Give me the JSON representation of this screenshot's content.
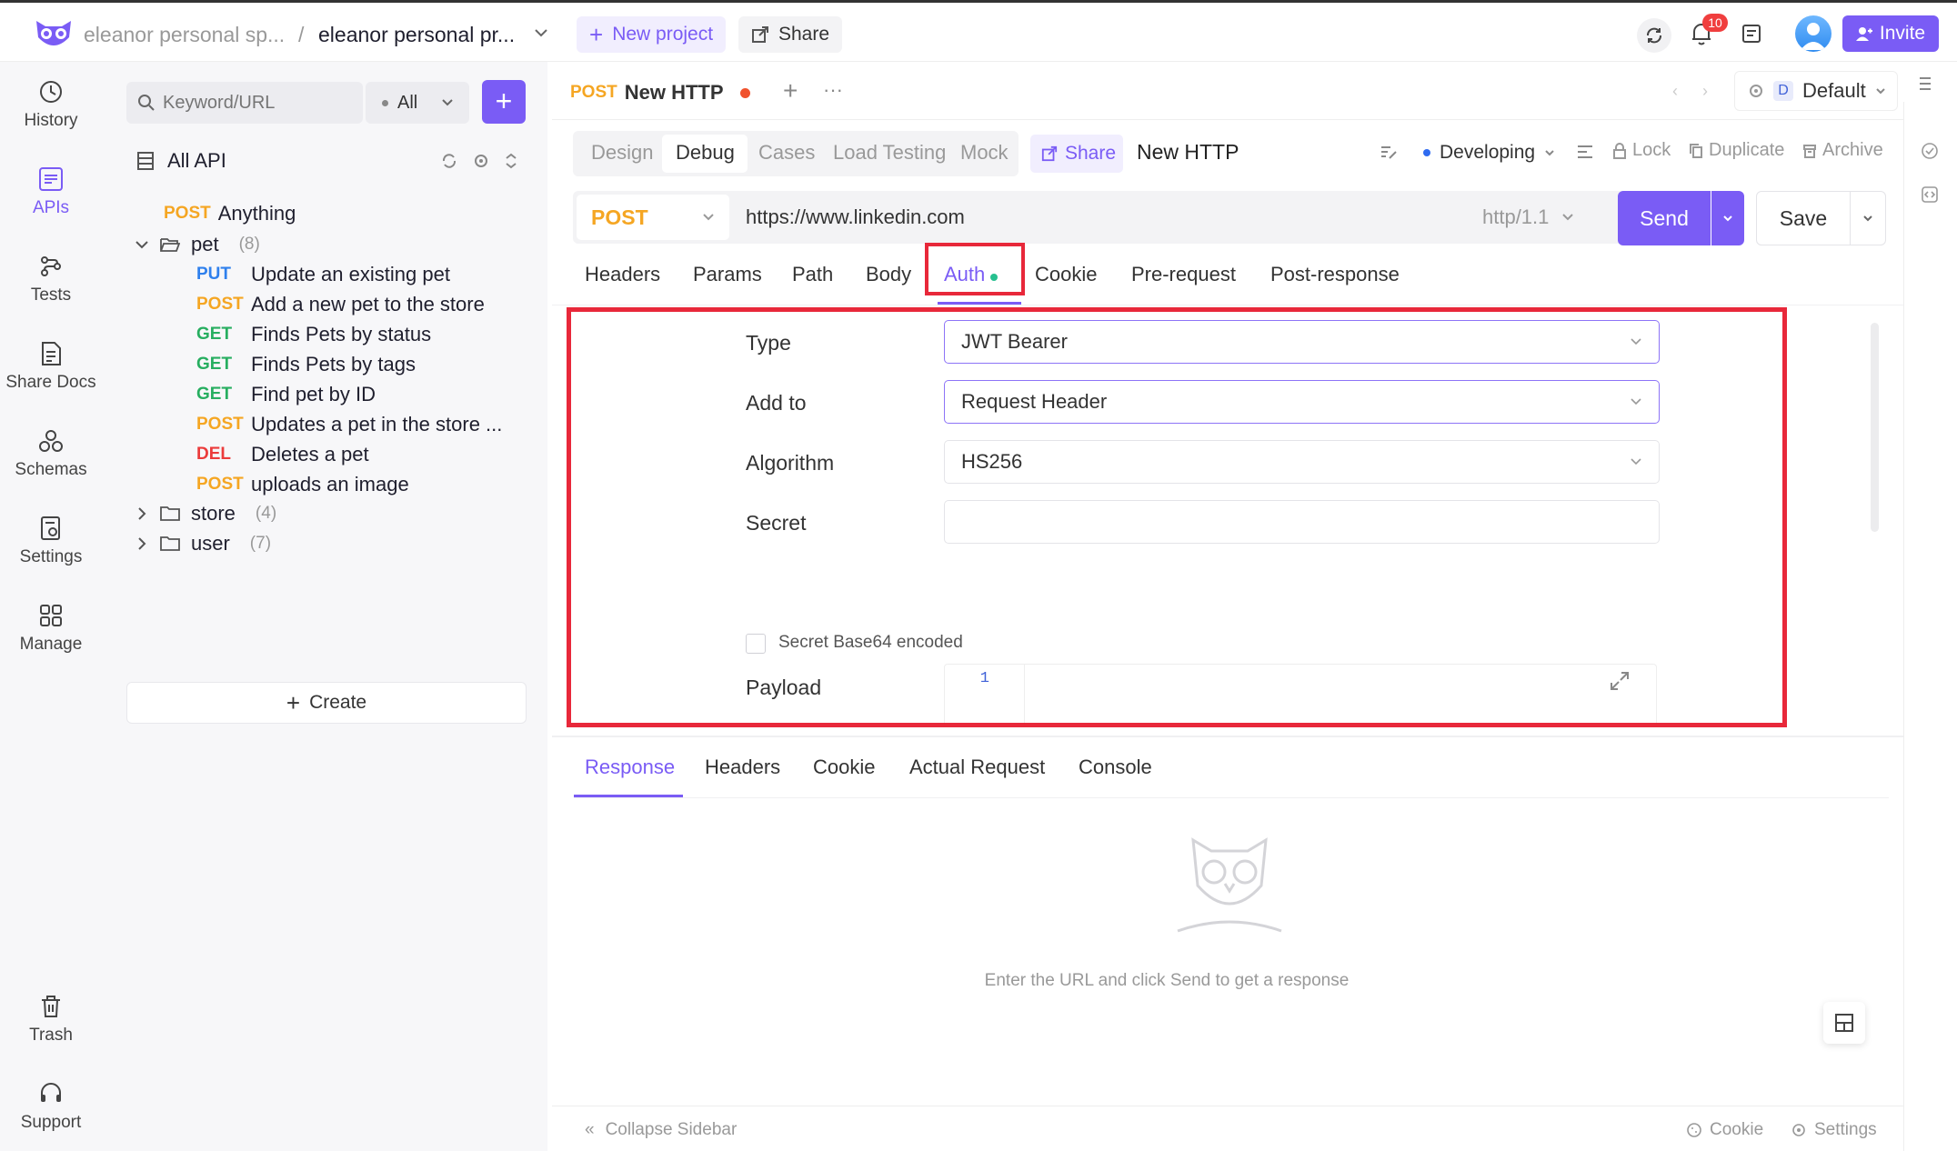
{
  "header": {
    "workspace": "eleanor personal sp...",
    "separator": "/",
    "project": "eleanor personal pr...",
    "new_project": "New project",
    "share": "Share",
    "notif_count": "10",
    "invite": "Invite",
    "accent": "#7a5cf5"
  },
  "nav": [
    {
      "label": "History",
      "icon": "history-icon"
    },
    {
      "label": "APIs",
      "icon": "apis-icon"
    },
    {
      "label": "Tests",
      "icon": "tests-icon"
    },
    {
      "label": "Share Docs",
      "icon": "share-docs-icon"
    },
    {
      "label": "Schemas",
      "icon": "schemas-icon"
    },
    {
      "label": "Settings",
      "icon": "settings-icon"
    },
    {
      "label": "Manage",
      "icon": "manage-icon"
    },
    {
      "label": "Trash",
      "icon": "trash-icon"
    },
    {
      "label": "Support",
      "icon": "support-icon"
    }
  ],
  "sidebar": {
    "search_placeholder": "Keyword/URL",
    "filter": "All",
    "all_api": "All API",
    "tree": [
      {
        "method": "POST",
        "name": "Anything"
      },
      {
        "folder": "pet",
        "count": "(8)"
      },
      {
        "method": "PUT",
        "name": "Update an existing pet"
      },
      {
        "method": "POST",
        "name": "Add a new pet to the store"
      },
      {
        "method": "GET",
        "name": "Finds Pets by status"
      },
      {
        "method": "GET",
        "name": "Finds Pets by tags"
      },
      {
        "method": "GET",
        "name": "Find pet by ID"
      },
      {
        "method": "POST",
        "name": "Updates a pet in the store ..."
      },
      {
        "method": "DEL",
        "name": "Deletes a pet"
      },
      {
        "method": "POST",
        "name": "uploads an image"
      },
      {
        "folder": "store",
        "count": "(4)"
      },
      {
        "folder": "user",
        "count": "(7)"
      }
    ],
    "create": "Create"
  },
  "tabbar": {
    "method": "POST",
    "title": "New HTTP",
    "env_badge": "D",
    "env": "Default"
  },
  "modes": [
    "Design",
    "Debug",
    "Cases",
    "Load Testing",
    "Mock"
  ],
  "toolbar": {
    "share": "Share",
    "name": "New HTTP",
    "status": "Developing",
    "lock": "Lock",
    "duplicate": "Duplicate",
    "archive": "Archive"
  },
  "request": {
    "method": "POST",
    "url": "https://www.linkedin.com",
    "protocol": "http/1.1",
    "send": "Send",
    "save": "Save"
  },
  "req_tabs": [
    "Headers",
    "Params",
    "Path",
    "Body",
    "Auth",
    "Cookie",
    "Pre-request",
    "Post-response"
  ],
  "auth": {
    "type_label": "Type",
    "type_value": "JWT Bearer",
    "addto_label": "Add to",
    "addto_value": "Request Header",
    "algo_label": "Algorithm",
    "algo_value": "HS256",
    "secret_label": "Secret",
    "secret_value": "",
    "base64_label": "Secret Base64 encoded",
    "payload_label": "Payload",
    "payload_line": "1"
  },
  "resp_tabs": [
    "Response",
    "Headers",
    "Cookie",
    "Actual Request",
    "Console"
  ],
  "empty_msg": "Enter the URL and click Send to get a response",
  "footer": {
    "collapse": "Collapse Sidebar",
    "cookie": "Cookie",
    "settings": "Settings"
  }
}
